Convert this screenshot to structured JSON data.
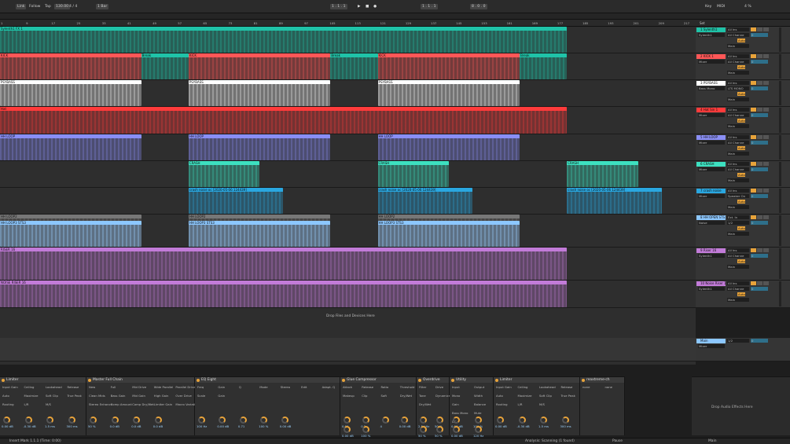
{
  "transport": {
    "link": "Link",
    "follow": "Follow",
    "tap": "Tap",
    "tempo": "130.00",
    "time_sig": "4 / 4",
    "quant": "1 Bar",
    "position": "1 . 1 . 1",
    "loop_start": "1 . 1 . 1",
    "loop_len": "8 . 0 . 0",
    "key": "Key",
    "midi": "MIDI",
    "cpu": "4 %"
  },
  "ruler": {
    "ticks": [
      "1",
      "9",
      "17",
      "25",
      "33",
      "41",
      "49",
      "57",
      "65",
      "73",
      "81",
      "89",
      "97",
      "105",
      "113",
      "121",
      "129",
      "137",
      "145",
      "153",
      "161",
      "169",
      "177",
      "185",
      "193",
      "201",
      "209",
      "217",
      "225"
    ],
    "set": "Set"
  },
  "tracks": [
    {
      "name": "1 Sylenth1",
      "color": "#1fc3a8",
      "h": 34,
      "clips": [
        {
          "name": "Sylenth1 FX 1",
          "s": 0,
          "e": 81.5
        }
      ],
      "sends": "All Ins",
      "ch": "All Channe",
      "mon": "Auto",
      "out": "Main",
      "inst": "Sylenth1",
      "vol": "0"
    },
    {
      "name": "2 KICK 1",
      "color": "#ff5757",
      "h": 34,
      "clips": [
        {
          "name": "KICK",
          "s": 0,
          "e": 20.3,
          "c": "#ff5757"
        },
        {
          "name": "Break",
          "s": 20.3,
          "e": 27.1,
          "c": "#1fc3a8"
        },
        {
          "name": "KICK",
          "s": 27.1,
          "e": 47.5,
          "c": "#ff5757"
        },
        {
          "name": "Break",
          "s": 47.5,
          "e": 54.3,
          "c": "#1fc3a8"
        },
        {
          "name": "KICK",
          "s": 54.3,
          "e": 74.7,
          "c": "#ff5757"
        },
        {
          "name": "Break",
          "s": 74.7,
          "e": 81.5,
          "c": "#1fc3a8"
        }
      ],
      "sends": "All Ins",
      "ch": "All Channe",
      "mon": "Auto",
      "out": "Main",
      "inst": "Mixer",
      "vol": "0"
    },
    {
      "name": "3 PSYBASS",
      "color": "#ffffff",
      "h": 34,
      "clips": [
        {
          "name": "PSYBASS",
          "s": 0,
          "e": 20.3,
          "c": "#ffffff"
        },
        {
          "name": "PSYBASS",
          "s": 27.1,
          "e": 47.5,
          "c": "#ffffff"
        },
        {
          "name": "PSYBASS",
          "s": 54.3,
          "e": 74.7,
          "c": "#ffffff"
        }
      ],
      "sends": "All Ins",
      "ch": "LTS MONO",
      "mon": "Auto",
      "out": "Main",
      "inst": "Bass Mono",
      "vol": "0"
    },
    {
      "name": "4 Hat Sin 1",
      "color": "#ff3b3b",
      "h": 35,
      "clips": [
        {
          "name": "Hat",
          "s": 0,
          "e": 81.5
        }
      ],
      "sends": "All Ins",
      "ch": "All Channe",
      "mon": "Auto",
      "out": "Main",
      "inst": "Mixer",
      "vol": "0"
    },
    {
      "name": "5 HH LOOP",
      "color": "#8a8ef5",
      "h": 34,
      "clips": [
        {
          "name": "HH LOOP",
          "s": 0,
          "e": 20.3
        },
        {
          "name": "HH LOOP",
          "s": 27.1,
          "e": 47.5
        },
        {
          "name": "HH LOOP",
          "s": 54.3,
          "e": 74.7
        }
      ],
      "sends": "All Ins",
      "ch": "All Channe",
      "mon": "Auto",
      "out": "Main",
      "inst": "Mixer",
      "vol": "0"
    },
    {
      "name": "6 CRASH",
      "color": "#3de0c0",
      "h": 34,
      "clips": [
        {
          "name": "CRASH",
          "s": 27.1,
          "e": 37.3
        },
        {
          "name": "CRASH",
          "s": 54.3,
          "e": 64.5
        },
        {
          "name": "CRASH",
          "s": 81.5,
          "e": 91.7
        }
      ],
      "sends": "All Ins",
      "ch": "All Channe",
      "mon": "Auto",
      "out": "Main",
      "inst": "Mixer",
      "vol": "0"
    },
    {
      "name": "7 crash noise",
      "color": "#2aa7e0",
      "h": 34,
      "clips": [
        {
          "name": "crash noise oc [2020-05-06 124439]",
          "s": 27.1,
          "e": 40.7
        },
        {
          "name": "crash noise oc [2020-05-06 124439]",
          "s": 54.3,
          "e": 67.9
        },
        {
          "name": "crash noise oc [2020-05-06 124439]",
          "s": 81.5,
          "e": 95.1
        }
      ],
      "sends": "All Ins",
      "ch": "Speaker On",
      "mon": "Auto",
      "out": "Main",
      "inst": "Mixer",
      "vol": "0"
    },
    {
      "name": "8 HH OPEN STS",
      "color": "#8cc7ff",
      "h": 42,
      "clips": [
        {
          "name": "HH LOOP2",
          "s": 0,
          "e": 20.3,
          "c": "#777777"
        },
        {
          "name": "HH LOOP2",
          "s": 27.1,
          "e": 47.5,
          "c": "#777777"
        },
        {
          "name": "HH LOOP2",
          "s": 54.3,
          "e": 74.7,
          "c": "#777777"
        },
        {
          "name": "HH LOOP3 STS3",
          "s": 0,
          "e": 20.3,
          "c": "#8cc7ff",
          "y": 8
        },
        {
          "name": "HH LOOP3 STS3",
          "s": 27.1,
          "e": 47.5,
          "c": "#8cc7ff",
          "y": 8
        },
        {
          "name": "HH LOOP3 STS3",
          "s": 54.3,
          "e": 74.7,
          "c": "#8cc7ff",
          "y": 8
        }
      ],
      "sends": "Ext. In",
      "ch": "1/2",
      "mon": "Auto",
      "out": "Main",
      "inst": "Noise",
      "vol": "0"
    },
    {
      "name": "9 Riser 16",
      "color": "#c27bd8",
      "h": 42,
      "clips": [
        {
          "name": "RISER 16",
          "s": 0,
          "e": 81.5
        }
      ],
      "sends": "All Ins",
      "ch": "All Channe",
      "mon": "Auto",
      "out": "Main",
      "inst": "Sylenth1",
      "vol": "0"
    },
    {
      "name": "10 Noise Riser 16",
      "color": "#c27bd8",
      "h": 35,
      "clips": [
        {
          "name": "NOISE RISER 16",
          "s": 0,
          "e": 81.5
        }
      ],
      "sends": "All Ins",
      "ch": "All Channe",
      "mon": "Auto",
      "out": "Main",
      "inst": "Sylenth1",
      "vol": "0"
    }
  ],
  "drop_files": "Drop Files and Devices Here",
  "main_track": {
    "name": "Main",
    "ch": "1/2",
    "inst": "Mixer",
    "vol": "0"
  },
  "devices": [
    {
      "name": "Limiter",
      "w": 110,
      "labels": [
        "Input Gain",
        "Ceiling",
        "Lookahead",
        "Release",
        "Auto",
        "Maximize",
        "Soft Clip",
        "True Peak",
        "Routing",
        "L/R",
        "M/S"
      ],
      "values": [
        "0.00 dB",
        "-0.30 dB",
        "1.5 ms",
        "300 ms"
      ]
    },
    {
      "name": "Master Full Chain",
      "w": 138,
      "labels": [
        "New",
        "Full",
        "Mid Drive",
        "Wide Parallel",
        "Parallel Drive",
        "Clean Mids",
        "Bass Gain",
        "Mid Gain",
        "High Gain",
        "Over Drive",
        "Stereo Enhance",
        "Comp Amount",
        "Comp Dry/Wet",
        "Limiter Gain",
        "Macro Variations"
      ],
      "values": [
        "50 %",
        "0.0 dB",
        "0.0 dB",
        "0.0 dB"
      ]
    },
    {
      "name": "EQ Eight",
      "w": 185,
      "labels": [
        "Freq",
        "Gain",
        "Q",
        "Mode",
        "Stereo",
        "Edit",
        "Adapt. Q",
        "Scale",
        "Gain"
      ],
      "values": [
        "100 Hz",
        "0.00 dB",
        "0.71",
        "100 %",
        "0.00 dB"
      ]
    },
    {
      "name": "Glue Compressor",
      "w": 97,
      "labels": [
        "Attack",
        "Release",
        "Ratio",
        "Threshold",
        "Makeup",
        "Clip",
        "Soft",
        "Dry/Wet"
      ],
      "values": [
        "0.01",
        "0.2",
        "4",
        "0.00 dB",
        "0.00 dB",
        "100 %"
      ]
    },
    {
      "name": "Overdrive",
      "w": 42,
      "labels": [
        "Filter",
        "Drive",
        "Tone",
        "Dynamics",
        "Dry/Wet"
      ],
      "values": [
        "2.5 kHz",
        "50 %",
        "50 %",
        "50 %"
      ]
    },
    {
      "name": "Utility",
      "w": 56,
      "labels": [
        "Input",
        "Output",
        "Mono",
        "Width",
        "Gain",
        "Balance",
        "Bass Mono",
        "Mute",
        "DC"
      ],
      "values": [
        "0.00 dB",
        "100 %",
        "0.00 dB",
        "120 Hz"
      ]
    },
    {
      "name": "Limiter",
      "w": 110,
      "labels": [
        "Input Gain",
        "Ceiling",
        "Lookahead",
        "Release",
        "Auto",
        "Maximize",
        "Soft Clip",
        "True Peak",
        "Routing",
        "L/R",
        "M/S"
      ],
      "values": [
        "0.00 dB",
        "-0.30 dB",
        "1.5 ms",
        "300 ms"
      ]
    },
    {
      "name": "reaxtreme-ch",
      "w": 57,
      "labels": [
        "none",
        "none"
      ],
      "values": []
    }
  ],
  "drop_effects": "Drop Audio Effects Here",
  "status": {
    "left": "Insert Mark 1.1.1 (Time: 0:00)",
    "analysis": "Analysis: Scanning (1 found)",
    "pause": "Pause",
    "main": "Main"
  }
}
